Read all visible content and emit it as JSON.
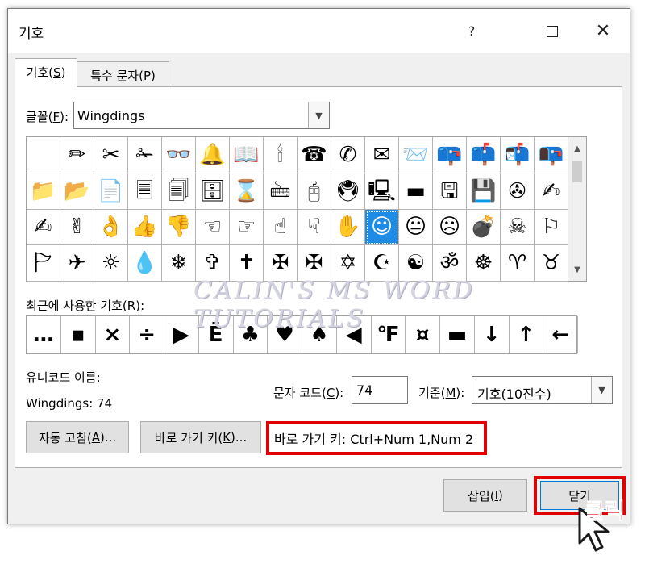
{
  "window": {
    "title": "기호",
    "help_icon": "?",
    "max_icon": "maximize-icon",
    "close_icon": "✕"
  },
  "tabs": [
    {
      "label_pre": "기호(",
      "key": "S",
      "label_post": ")"
    },
    {
      "label_pre": "특수 문자(",
      "key": "P",
      "label_post": ")"
    }
  ],
  "font": {
    "label_pre": "글꼴(",
    "key": "F",
    "label_post": "):",
    "value": "Wingdings"
  },
  "symbols": [
    [
      "",
      "✏",
      "✂",
      "✁",
      "👓",
      "🔔",
      "📖",
      "🕯",
      "☎",
      "✆",
      "✉",
      "📨",
      "📪",
      "📫",
      "📬",
      "📭"
    ],
    [
      "📁",
      "📂",
      "📄",
      "🗏",
      "🗐",
      "🗄",
      "⌛",
      "🖮",
      "🖰",
      "🖲",
      "🖳",
      "▬",
      "🖫",
      "💾",
      "✇",
      "✍"
    ],
    [
      "✍",
      "✌",
      "👌",
      "👍",
      "👎",
      "☜",
      "☞",
      "☝",
      "☟",
      "✋",
      "☺",
      "😐",
      "☹",
      "💣",
      "☠",
      "⚐"
    ],
    [
      "🏱",
      "✈",
      "☼",
      "💧",
      "❄",
      "✞",
      "✝",
      "✠",
      "✠",
      "✡",
      "☪",
      "☯",
      "ॐ",
      "☸",
      "♈",
      "♉"
    ]
  ],
  "selected": {
    "row": 2,
    "col": 10
  },
  "watermark": "CALIN'S MS WORD TUTORIALS",
  "recent": {
    "label_pre": "최근에 사용한 기호(",
    "key": "R",
    "label_post": "):",
    "symbols": [
      "…",
      "▪",
      "×",
      "÷",
      "▶",
      "Ë",
      "♣",
      "♥",
      "♠",
      "◀",
      "℉",
      "¤",
      "▬",
      "↓",
      "↑",
      "←"
    ]
  },
  "unicode_name_label": "유니코드 이름:",
  "unicode_name_value": "Wingdings: 74",
  "char_code": {
    "label_pre": "문자 코드(",
    "key": "C",
    "label_post": "):",
    "value": "74"
  },
  "base": {
    "label_pre": "기준(",
    "key": "M",
    "label_post": "):",
    "value": "기호(10진수)"
  },
  "buttons": {
    "autocorrect": {
      "pre": "자동 고침(",
      "key": "A",
      "post": ")..."
    },
    "shortcut_key": {
      "pre": "바로 가기 키(",
      "key": "K",
      "post": ")..."
    },
    "insert": {
      "pre": "삽입(",
      "key": "I",
      "post": ")"
    },
    "close": "닫기"
  },
  "shortcut_text": "바로 가기 키: Ctrl+Num 1,Num 2",
  "click_annotation": "클릭",
  "colors": {
    "highlight": "#e00000",
    "selection": "#1e8be6"
  }
}
